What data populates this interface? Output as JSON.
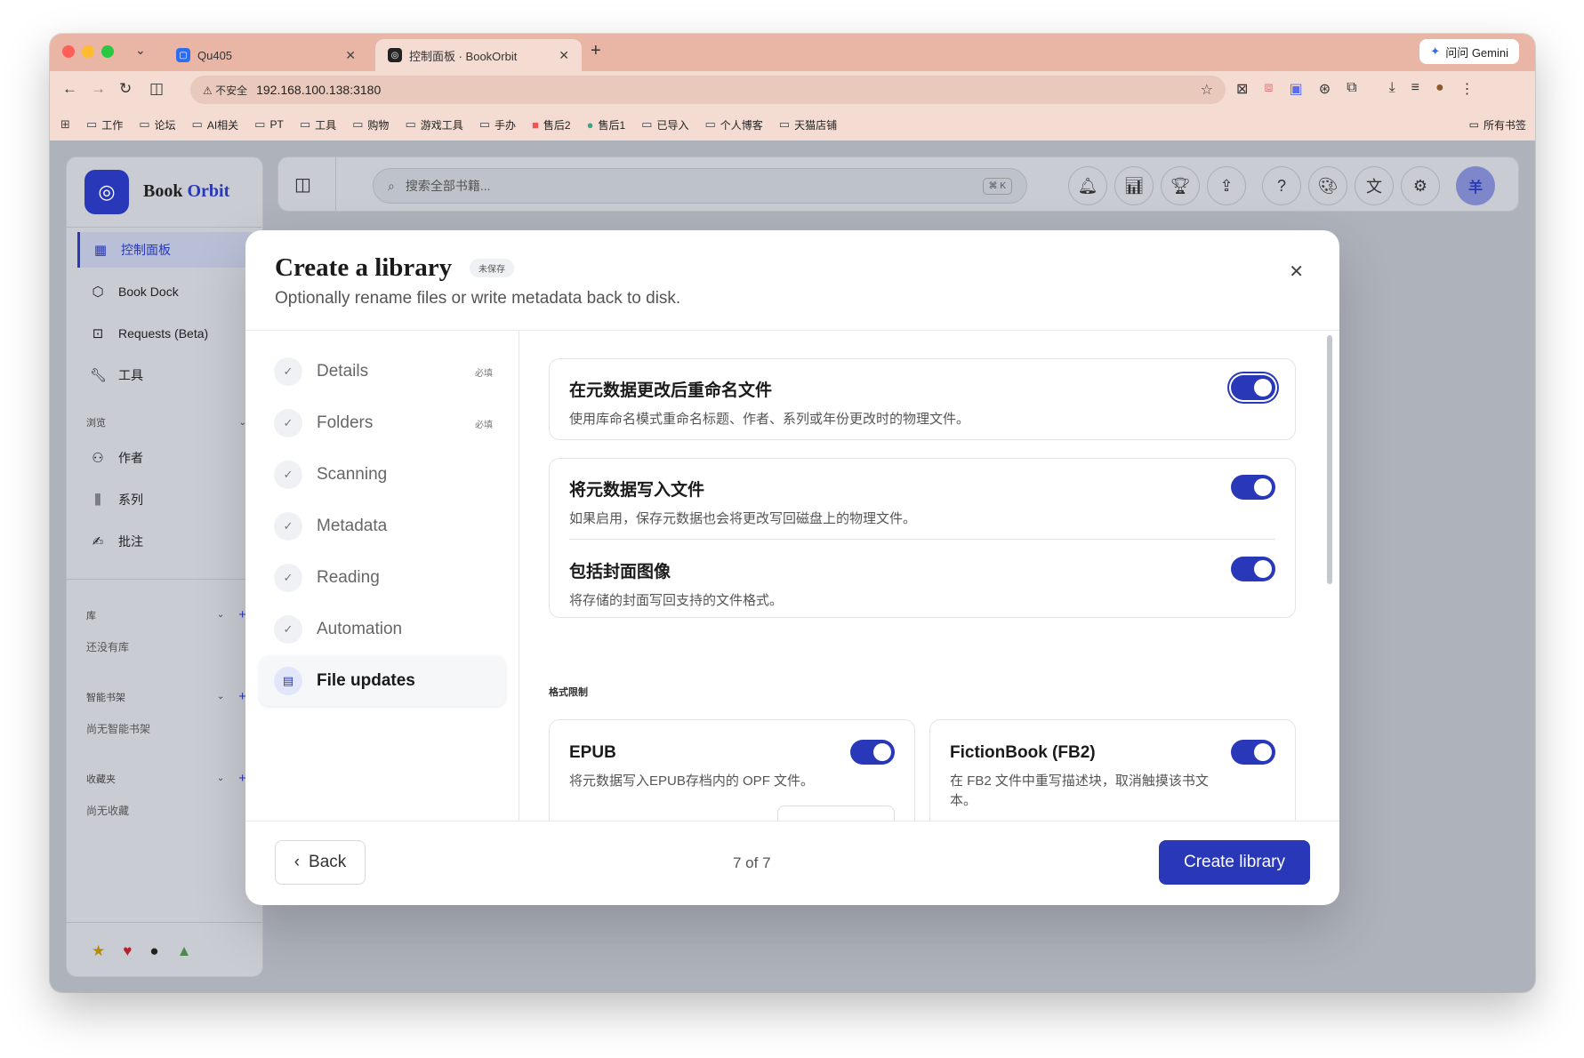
{
  "browser": {
    "tabs": [
      {
        "title": "Qu405",
        "favicon": "qu-icon"
      },
      {
        "title": "控制面板 · BookOrbit",
        "favicon": "bookorbit-icon"
      }
    ],
    "gemini_label": "问问 Gemini",
    "address": {
      "security": "不安全",
      "url": "192.168.100.138:3180"
    },
    "bookmarks": [
      "工作",
      "论坛",
      "AI相关",
      "PT",
      "工具",
      "购物",
      "游戏工具",
      "手办",
      "售后2",
      "售后1",
      "已导入",
      "个人博客",
      "天猫店铺"
    ],
    "all_bookmarks": "所有书签"
  },
  "sidebar": {
    "brand_a": "Book",
    "brand_b": "Orbit",
    "nav": [
      {
        "label": "控制面板",
        "icon": "grid-icon"
      },
      {
        "label": "Book Dock",
        "icon": "box-icon"
      },
      {
        "label": "Requests (Beta)",
        "icon": "request-icon"
      },
      {
        "label": "工具",
        "icon": "wrench-icon"
      }
    ],
    "browse_label": "浏览",
    "browse": [
      {
        "label": "作者",
        "icon": "users-icon"
      },
      {
        "label": "系列",
        "icon": "library-icon"
      },
      {
        "label": "批注",
        "icon": "signature-icon"
      }
    ],
    "library_label": "库",
    "library_empty": "还没有库",
    "shelves_label": "智能书架",
    "shelves_empty": "尚无智能书架",
    "favorites_label": "收藏夹",
    "favorites_empty": "尚无收藏"
  },
  "topbar": {
    "search_placeholder": "搜索全部书籍...",
    "search_shortcut": "⌘ K",
    "avatar": "羊"
  },
  "modal": {
    "title": "Create a library",
    "badge": "未保存",
    "subtitle": "Optionally rename files or write metadata back to disk.",
    "steps": [
      {
        "label": "Details",
        "required": "必填"
      },
      {
        "label": "Folders",
        "required": "必填"
      },
      {
        "label": "Scanning",
        "required": ""
      },
      {
        "label": "Metadata",
        "required": ""
      },
      {
        "label": "Reading",
        "required": ""
      },
      {
        "label": "Automation",
        "required": ""
      },
      {
        "label": "File updates",
        "required": ""
      }
    ],
    "rename": {
      "title": "在元数据更改后重命名文件",
      "desc": "使用库命名模式重命名标题、作者、系列或年份更改时的物理文件。",
      "enabled": true
    },
    "write_meta": {
      "title": "将元数据写入文件",
      "desc": "如果启用，保存元数据也会将更改写回磁盘上的物理文件。",
      "enabled": true
    },
    "cover": {
      "title": "包括封面图像",
      "desc": "将存储的封面写回支持的文件格式。",
      "enabled": true
    },
    "format_label": "格式限制",
    "formats": [
      {
        "title": "EPUB",
        "desc": "将元数据写入EPUB存档内的 OPF 文件。",
        "enabled": true
      },
      {
        "title": "FictionBook (FB2)",
        "desc": "在 FB2 文件中重写描述块，取消触摸该书文本。",
        "enabled": true
      }
    ],
    "back_label": "Back",
    "page_indicator": "7 of 7",
    "create_label": "Create library"
  }
}
